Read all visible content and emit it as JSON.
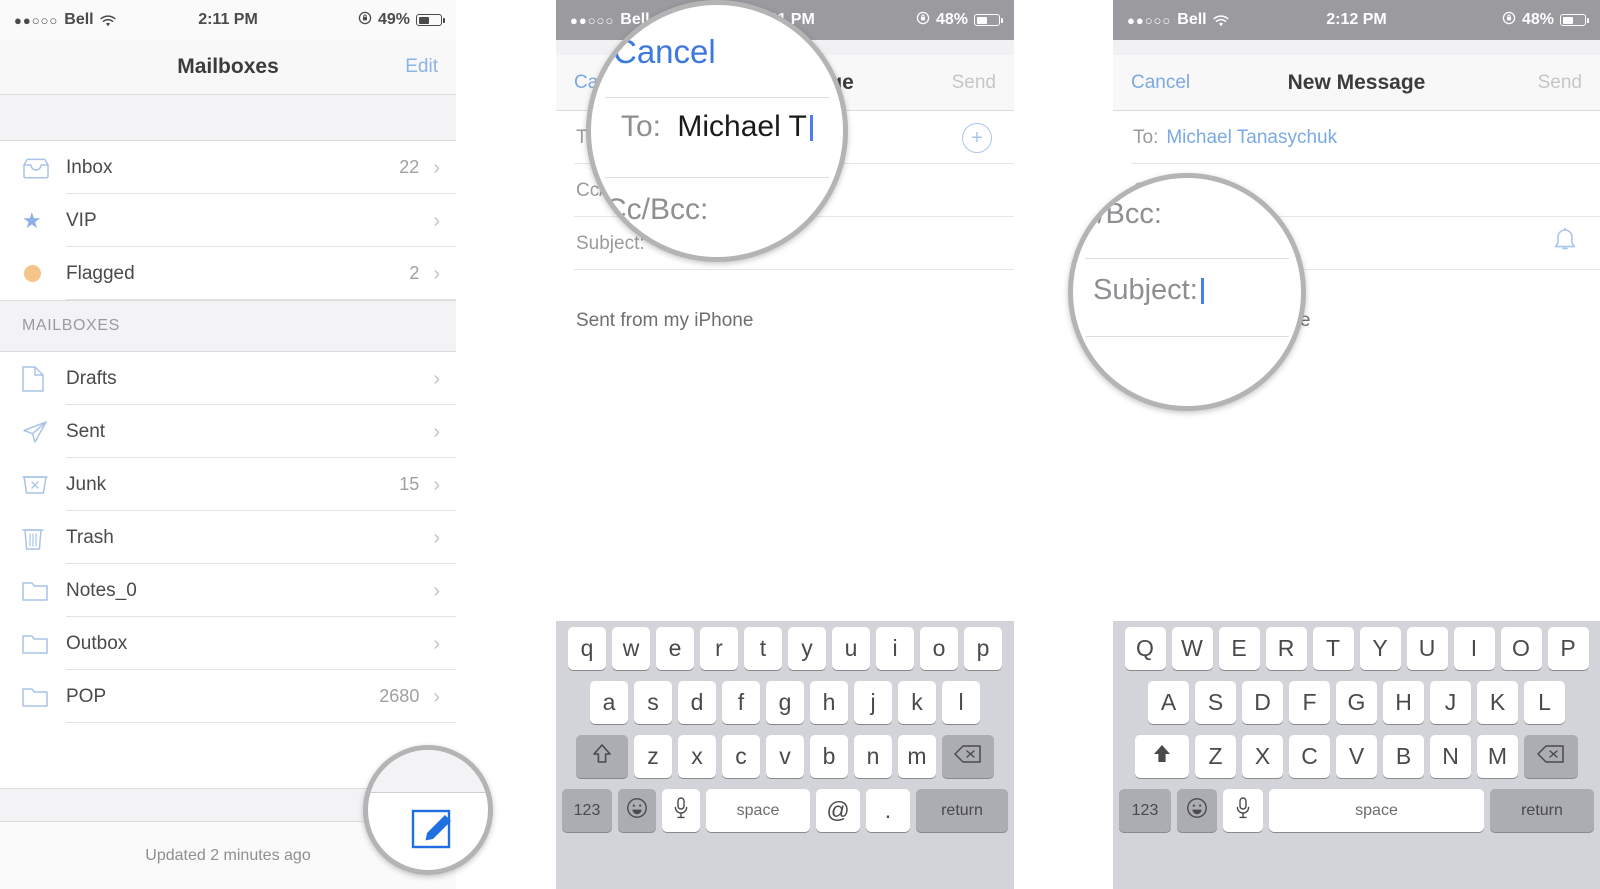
{
  "panels": {
    "mailboxes": {
      "status": {
        "carrier": "Bell",
        "dots": "●●○○○",
        "time": "2:11 PM",
        "battery_pct": "49%",
        "wifi_icon": "wifi-icon",
        "lock_icon": "rotation-lock-icon",
        "battery_icon": "battery-icon"
      },
      "nav": {
        "title": "Mailboxes",
        "edit": "Edit"
      },
      "section_header": "MAILBOXES",
      "top_rows": [
        {
          "label": "Inbox",
          "count": "22",
          "icon": "inbox-icon"
        },
        {
          "label": "VIP",
          "count": "",
          "icon": "star-icon"
        },
        {
          "label": "Flagged",
          "count": "2",
          "icon": "flag-dot-icon"
        }
      ],
      "mailbox_rows": [
        {
          "label": "Drafts",
          "count": "",
          "icon": "document-icon"
        },
        {
          "label": "Sent",
          "count": "",
          "icon": "paper-plane-icon"
        },
        {
          "label": "Junk",
          "count": "15",
          "icon": "junk-bin-icon"
        },
        {
          "label": "Trash",
          "count": "",
          "icon": "trash-icon"
        },
        {
          "label": "Notes_0",
          "count": "",
          "icon": "folder-icon"
        },
        {
          "label": "Outbox",
          "count": "",
          "icon": "folder-icon"
        },
        {
          "label": "POP",
          "count": "2680",
          "icon": "folder-icon"
        }
      ],
      "toolbar": {
        "updated": "Updated 2 minutes ago",
        "compose_icon": "compose-icon"
      },
      "magnifier": {
        "target": "compose-button"
      }
    },
    "compose_to": {
      "status": {
        "carrier": "Bell",
        "dots": "●●○○○",
        "time": "2:11 PM",
        "battery_pct": "48%"
      },
      "nav": {
        "cancel": "Cancel",
        "title": "New Message",
        "send": "Send"
      },
      "fields": [
        {
          "label": "To:",
          "value": ""
        },
        {
          "label": "Cc/Bcc:",
          "value": ""
        },
        {
          "label": "Subject:",
          "value": ""
        }
      ],
      "signature": "Sent from my iPhone",
      "magnifier": {
        "cancel": "Cancel",
        "to_label": "To:",
        "to_value": "Michael T",
        "cc_label": "Cc/Bcc:"
      },
      "keyboard": {
        "row1": [
          "q",
          "w",
          "e",
          "r",
          "t",
          "y",
          "u",
          "i",
          "o",
          "p"
        ],
        "row2": [
          "a",
          "s",
          "d",
          "f",
          "g",
          "h",
          "j",
          "k",
          "l"
        ],
        "row3": [
          "z",
          "x",
          "c",
          "v",
          "b",
          "n",
          "m"
        ],
        "shift_icon": "shift-outline-icon",
        "backspace_icon": "backspace-icon",
        "numbers_key": "123",
        "emoji_icon": "emoji-icon",
        "mic_icon": "microphone-icon",
        "space_key": "space",
        "at_key": "@",
        "period_key": ".",
        "return_key": "return"
      }
    },
    "compose_subject": {
      "status": {
        "carrier": "Bell",
        "dots": "●●○○○",
        "time": "2:12 PM",
        "battery_pct": "48%"
      },
      "nav": {
        "cancel": "Cancel",
        "title": "New Message",
        "send": "Send"
      },
      "fields": [
        {
          "label": "To:",
          "value": "Michael Tanasychuk"
        },
        {
          "label": "Cc/Bcc:",
          "value": ""
        },
        {
          "label": "Subject:",
          "value": ""
        }
      ],
      "bell_icon": "bell-icon",
      "signature": "Sent from my iPhone",
      "magnifier": {
        "cc_label": "c/Bcc:",
        "subject_label": "Subject:"
      },
      "keyboard": {
        "row1": [
          "Q",
          "W",
          "E",
          "R",
          "T",
          "Y",
          "U",
          "I",
          "O",
          "P"
        ],
        "row2": [
          "A",
          "S",
          "D",
          "F",
          "G",
          "H",
          "J",
          "K",
          "L"
        ],
        "row3": [
          "Z",
          "X",
          "C",
          "V",
          "B",
          "N",
          "M"
        ],
        "shift_icon": "shift-solid-icon",
        "backspace_icon": "backspace-icon",
        "numbers_key": "123",
        "emoji_icon": "emoji-icon",
        "mic_icon": "microphone-icon",
        "space_key": "space",
        "return_key": "return"
      }
    }
  },
  "colors": {
    "accent_blue": "#7aa9e4",
    "icon_blue": "#a8c4e8",
    "flag_orange": "#f4c48a",
    "caret_blue": "#4a7ef0",
    "status_gray": "#9a9a9f",
    "keyboard_bg": "#d2d4da"
  }
}
